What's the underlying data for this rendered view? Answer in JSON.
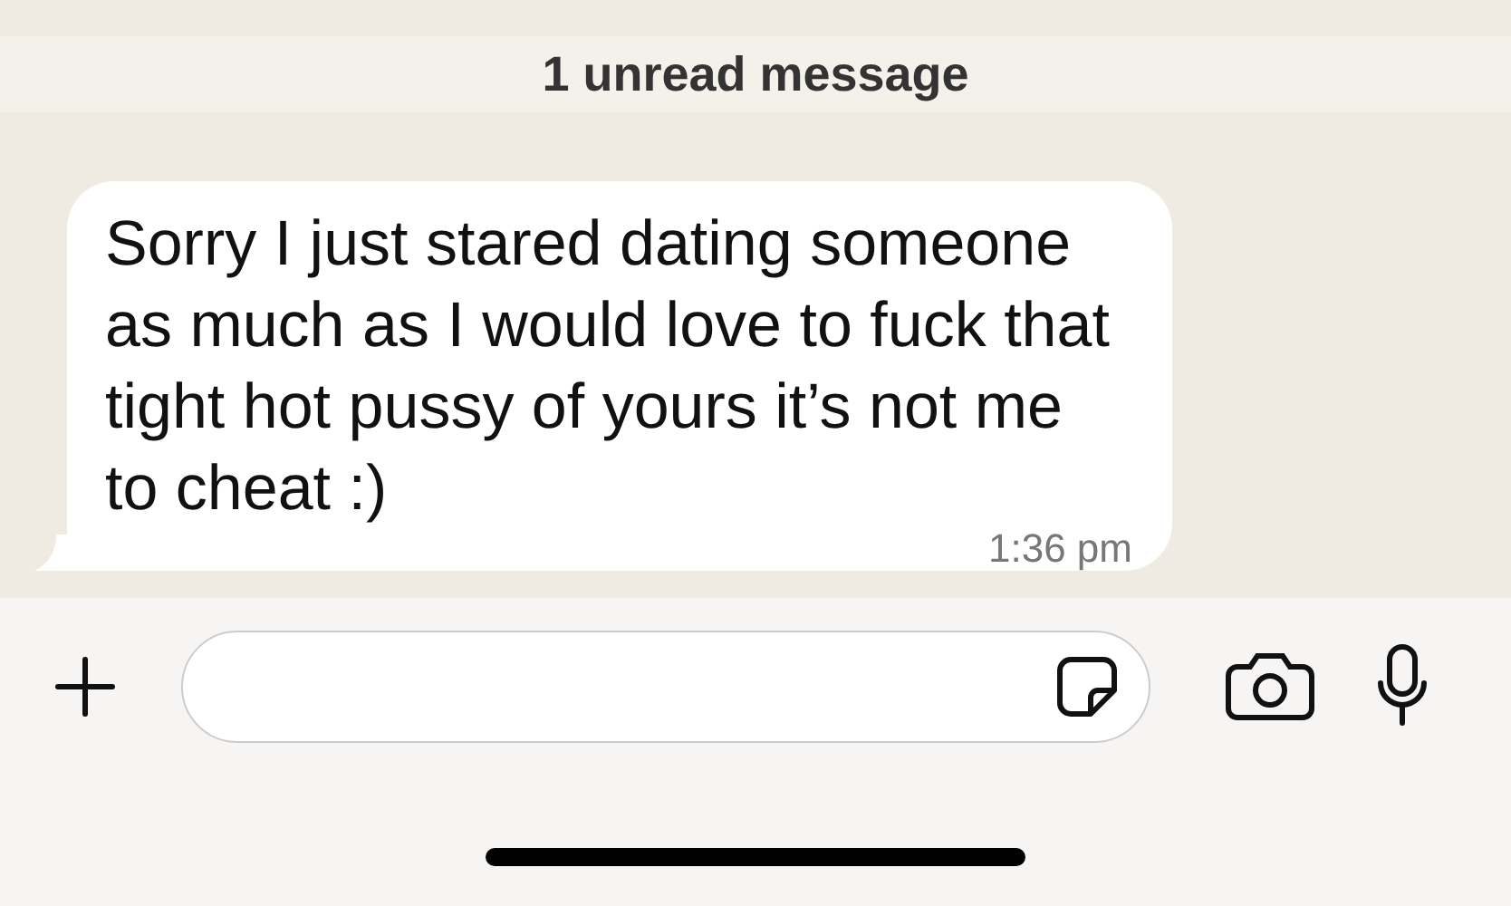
{
  "unread_banner": "1 unread message",
  "message": {
    "text": "Sorry I just stared dating someone as much as I would love to fuck that tight hot pussy of yours it’s not me to cheat :)",
    "time": "1:36 pm"
  }
}
